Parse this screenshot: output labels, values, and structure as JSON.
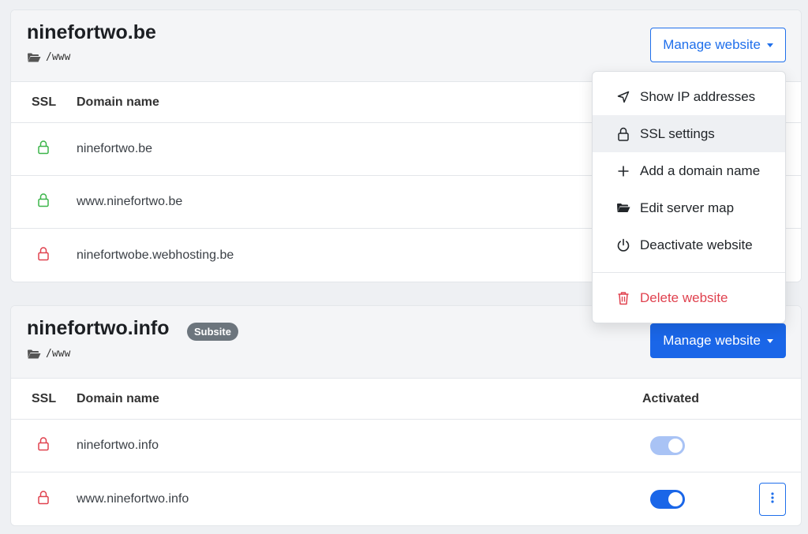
{
  "sites": [
    {
      "title": "ninefortwo.be",
      "path": "/www",
      "manage_label": "Manage website",
      "columns": {
        "ssl": "SSL",
        "domain": "Domain name"
      },
      "domains": [
        {
          "name": "ninefortwo.be",
          "ssl": "secure"
        },
        {
          "name": "www.ninefortwo.be",
          "ssl": "secure"
        },
        {
          "name": "ninefortwobe.webhosting.be",
          "ssl": "insecure"
        }
      ]
    },
    {
      "title": "ninefortwo.info",
      "badge": "Subsite",
      "path": "/www",
      "manage_label": "Manage website",
      "columns": {
        "ssl": "SSL",
        "domain": "Domain name",
        "activated": "Activated"
      },
      "domains": [
        {
          "name": "ninefortwo.info",
          "ssl": "insecure",
          "activated": "pending"
        },
        {
          "name": "www.ninefortwo.info",
          "ssl": "insecure",
          "activated": "on"
        }
      ]
    }
  ],
  "menu": {
    "items": [
      {
        "label": "Show IP addresses",
        "icon": "location-arrow-icon"
      },
      {
        "label": "SSL settings",
        "icon": "lock-icon"
      },
      {
        "label": "Add a domain name",
        "icon": "plus-icon"
      },
      {
        "label": "Edit server map",
        "icon": "folder-open-icon"
      },
      {
        "label": "Deactivate website",
        "icon": "power-icon"
      }
    ],
    "danger_item": {
      "label": "Delete website",
      "icon": "trash-icon"
    }
  },
  "colors": {
    "primary": "#1a66e8",
    "ssl_secure": "#3cb54a",
    "ssl_insecure": "#e0424f",
    "danger": "#e0424f",
    "badge": "#6c757d"
  }
}
